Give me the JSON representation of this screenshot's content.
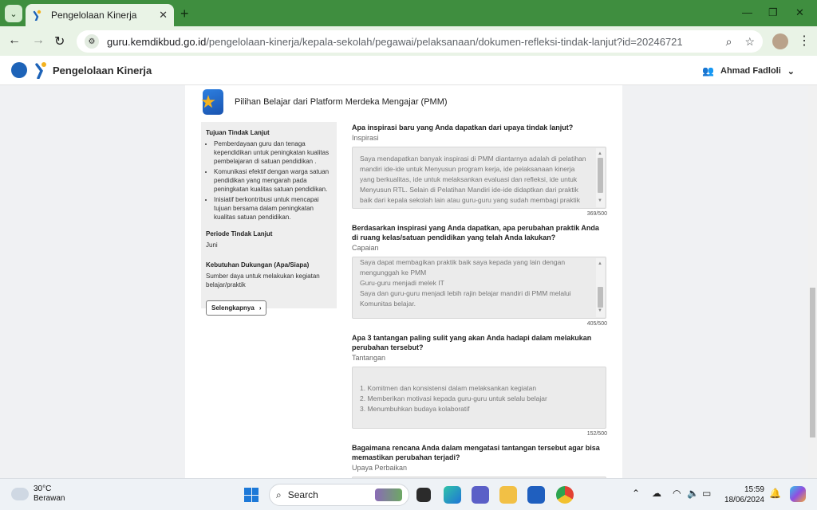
{
  "browser": {
    "tab_title": "Pengelolaan Kinerja",
    "url_domain": "guru.kemdikbud.go.id",
    "url_path": "/pengelolaan-kinerja/kepala-sekolah/pegawai/pelaksanaan/dokumen-refleksi-tindak-lanjut?id=20246721"
  },
  "header": {
    "app_title": "Pengelolaan Kinerja",
    "user_name": "Ahmad Fadloli"
  },
  "section": {
    "title": "Pilihan Belajar dari Platform Merdeka Mengajar (PMM)"
  },
  "sidebar": {
    "goal_heading": "Tujuan Tindak Lanjut",
    "goals": [
      "Pemberdayaan guru dan tenaga kependidikan untuk peningkatan kualitas pembelajaran di satuan pendidikan .",
      "Komunikasi efektif dengan warga satuan pendidikan yang mengarah pada peningkatan kualitas satuan pendidikan.",
      "Inisiatif berkontribusi untuk mencapai tujuan bersama dalam peningkatan kualitas satuan pendidikan."
    ],
    "period_heading": "Periode Tindak Lanjut",
    "period_value": "Juni",
    "support_heading": "Kebutuhan Dukungan (Apa/Siapa)",
    "support_value": "Sumber daya untuk melakukan kegiatan belajar/praktik",
    "more_button": "Selengkapnya"
  },
  "questions": [
    {
      "title": "Apa inspirasi baru yang Anda dapatkan dari upaya tindak lanjut?",
      "label": "Inspirasi",
      "text": "Saya mendapatkan banyak inspirasi di PMM diantarnya adalah di pelatihan mandiri ide-ide untuk Menyusun program kerja, ide pelaksanaan kinerja yang berkualitas, ide untuk melaksankan evaluasi dan refleksi, ide untuk Menyusun RTL. Selain di Pelatihan Mandiri ide-ide didaptkan dari praktik baik dari kepala sekolah lain atau guru-guru yang sudah membagi praktik baiknya.",
      "count": "369/500"
    },
    {
      "title": "Berdasarkan inspirasi yang Anda dapatkan, apa perubahan praktik Anda di ruang kelas/satuan pendidikan yang telah Anda lakukan?",
      "label": "Capaian",
      "text": "Saya dapat membagikan praktik baik saya kepada yang lain dengan mengunggah ke PMM\nGuru-guru menjadi melek IT\nSaya dan guru-guru menjadi lebih rajin belajar mandiri di PMM melalui Komunitas belajar.",
      "count": "405/500"
    },
    {
      "title": "Apa 3 tantangan paling sulit yang akan Anda hadapi dalam melakukan perubahan tersebut?",
      "label": "Tantangan",
      "text": "1. Komitmen dan konsistensi dalam melaksankan kegiatan\n2. Memberikan motivasi kepada guru-guru untuk selalu belajar\n3. Menumbuhkan budaya kolaboratif",
      "count": "152/500"
    },
    {
      "title": "Bagaimana rencana Anda dalam mengatasi tantangan tersebut agar bisa memastikan perubahan terjadi?",
      "label": "Upaya Perbaikan"
    }
  ],
  "taskbar": {
    "temperature": "30°C",
    "weather": "Berawan",
    "search_label": "Search",
    "time": "15:59",
    "date": "18/06/2024"
  }
}
